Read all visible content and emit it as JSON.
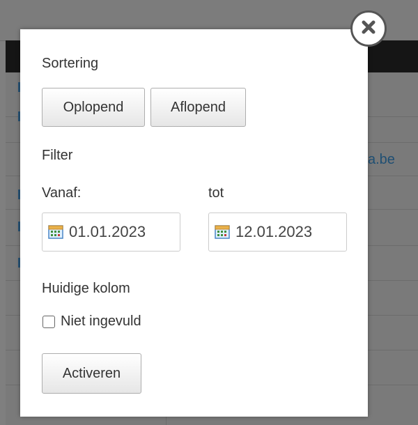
{
  "background": {
    "partial_link_text": "a.be"
  },
  "popup": {
    "sort_heading": "Sortering",
    "sort_ascending_label": "Oplopend",
    "sort_descending_label": "Aflopend",
    "filter_heading": "Filter",
    "from_label": "Vanaf:",
    "to_label": "tot",
    "from_date": "01.01.2023",
    "to_date": "12.01.2023",
    "current_column_heading": "Huidige kolom",
    "not_filled_label": "Niet ingevuld",
    "not_filled_checked": false,
    "activate_label": "Activeren",
    "close_icon": "close-icon",
    "calendar_icon": "calendar-icon"
  },
  "colors": {
    "overlay": "#7f7f7f",
    "header_bar": "#151515",
    "link": "#1f4f73",
    "popup_bg": "#ffffff"
  }
}
